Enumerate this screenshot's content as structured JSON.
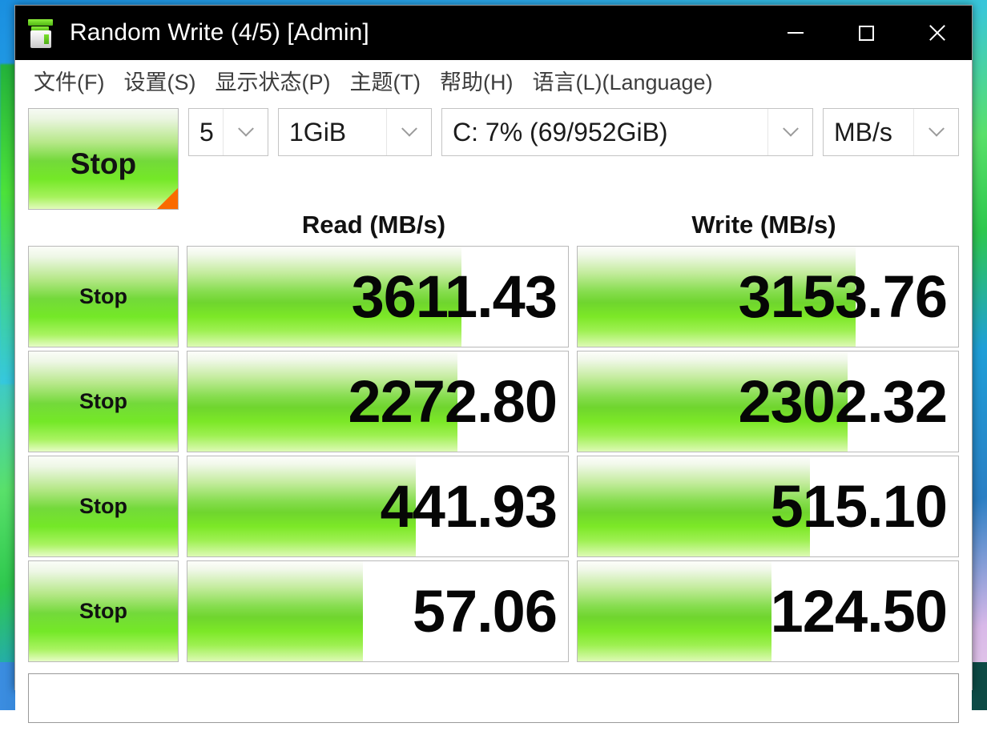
{
  "window": {
    "title": "Random Write (4/5) [Admin]",
    "icon": "crystaldiskmark-icon",
    "controls": {
      "minimize": "minimize-icon",
      "maximize": "maximize-icon",
      "close": "close-icon"
    }
  },
  "menu": {
    "items": [
      {
        "label": "文件(F)"
      },
      {
        "label": "设置(S)"
      },
      {
        "label": "显示状态(P)"
      },
      {
        "label": "主题(T)"
      },
      {
        "label": "帮助(H)"
      },
      {
        "label": "语言(L)(Language)"
      }
    ]
  },
  "toolbar": {
    "all_button_label": "Stop",
    "test_count": "5",
    "test_size": "1GiB",
    "target_drive": "C: 7% (69/952GiB)",
    "unit": "MB/s"
  },
  "results": {
    "headers": {
      "read": "Read (MB/s)",
      "write": "Write (MB/s)"
    },
    "rows": [
      {
        "button": "Stop",
        "read": "3611.43",
        "write": "3153.76"
      },
      {
        "button": "Stop",
        "read": "2272.80",
        "write": "2302.32"
      },
      {
        "button": "Stop",
        "read": "441.93",
        "write": "515.10"
      },
      {
        "button": "Stop",
        "read": "57.06",
        "write": "124.50"
      }
    ]
  },
  "status": {
    "text": ""
  },
  "bars": {
    "read": [
      "72%",
      "71%",
      "60%",
      "46%"
    ],
    "write": [
      "73%",
      "71%",
      "61%",
      "51%"
    ]
  },
  "colors": {
    "titlebar_bg": "#000000",
    "bar_green": "#7ae827",
    "accent_orange": "#fa6a00",
    "window_bg": "#ffffff"
  }
}
